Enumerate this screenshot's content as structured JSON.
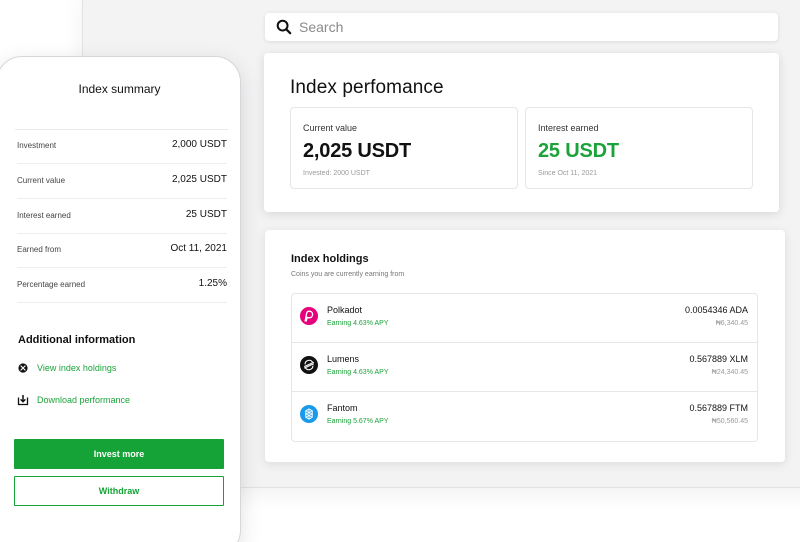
{
  "search": {
    "placeholder": "Search"
  },
  "performance": {
    "title": "Index perfomance",
    "current": {
      "label": "Current value",
      "value": "2,025 USDT",
      "sub": "Invested: 2000 USDT"
    },
    "interest": {
      "label": "Interest earned",
      "value": "25 USDT",
      "sub": "Since Oct 11, 2021"
    }
  },
  "holdings": {
    "title": "Index holdings",
    "subtitle": "Coins you are currently earning from",
    "items": [
      {
        "name": "Polkadot",
        "apy": "Earning 4.63% APY",
        "amount": "0.0054346 ADA",
        "ngn": "₦6,340.45",
        "icon": "polkadot-icon"
      },
      {
        "name": "Lumens",
        "apy": "Earning 4.63% APY",
        "amount": "0.567889 XLM",
        "ngn": "₦24,340.45",
        "icon": "stellar-icon"
      },
      {
        "name": "Fantom",
        "apy": "Earning 5.67% APY",
        "amount": "0.567889 FTM",
        "ngn": "₦50,560.45",
        "icon": "fantom-icon"
      }
    ]
  },
  "summary": {
    "title": "Index summary",
    "rows": [
      {
        "key": "Investment",
        "value": "2,000 USDT"
      },
      {
        "key": "Current value",
        "value": "2,025 USDT"
      },
      {
        "key": "Interest earned",
        "value": "25 USDT"
      },
      {
        "key": "Earned from",
        "value": "Oct 11, 2021"
      },
      {
        "key": "Percentage earned",
        "value": "1.25%"
      }
    ],
    "additional_title": "Additional information",
    "links": {
      "view": "View index holdings",
      "download": "Download performance"
    },
    "invest_label": "Invest more",
    "withdraw_label": "Withdraw"
  },
  "colors": {
    "accent": "#15a236",
    "polkadot": "#e6007a",
    "stellar": "#111111",
    "fantom": "#1a9ae8"
  }
}
